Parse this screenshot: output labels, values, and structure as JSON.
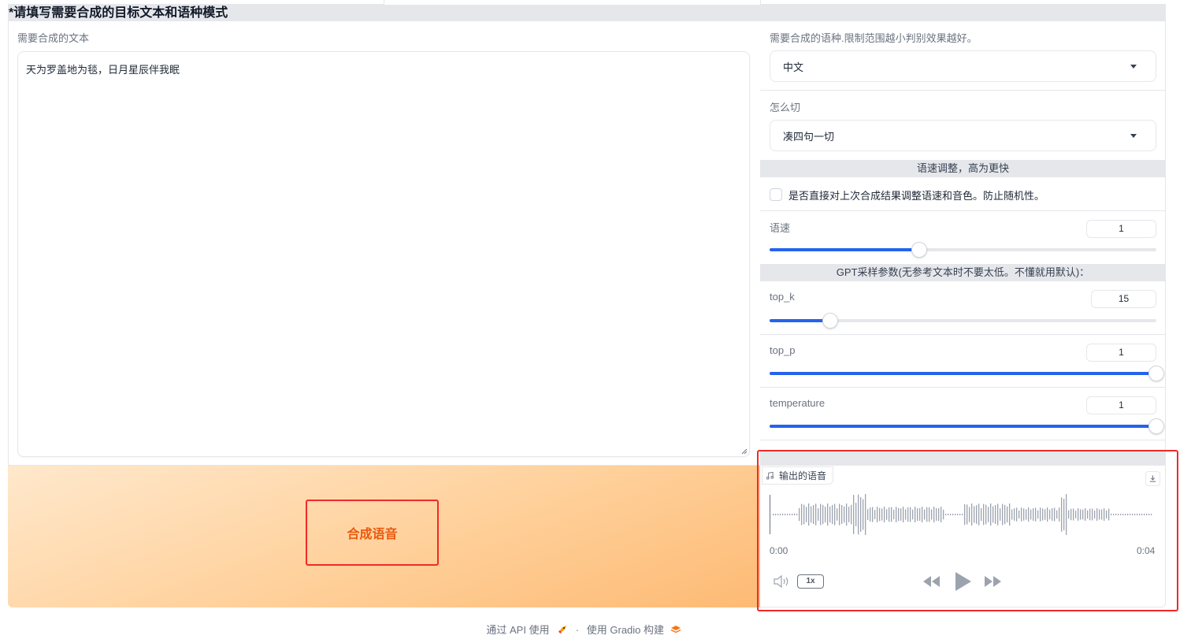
{
  "header": {
    "title": "*请填写需要合成的目标文本和语种模式"
  },
  "left": {
    "text_label": "需要合成的文本",
    "text_value": "天为罗盖地为毯，日月星辰伴我眠",
    "synth_button": "合成语音"
  },
  "right": {
    "language": {
      "label": "需要合成的语种.限制范围越小判别效果越好。",
      "value": "中文"
    },
    "cut": {
      "label": "怎么切",
      "value": "凑四句一切"
    },
    "speed_band": "语速调整，高为更快",
    "checkbox_label": "是否直接对上次合成结果调整语速和音色。防止随机性。",
    "speed": {
      "label": "语速",
      "value": "1",
      "fraction": 0.386
    },
    "gpt_band": "GPT采样参数(无参考文本时不要太低。不懂就用默认)：",
    "top_k": {
      "label": "top_k",
      "value": "15",
      "fraction": 0.156
    },
    "top_p": {
      "label": "top_p",
      "value": "1",
      "fraction": 1.0
    },
    "temperature": {
      "label": "temperature",
      "value": "1",
      "fraction": 1.0
    }
  },
  "audio": {
    "label": "输出的语音",
    "time_start": "0:00",
    "time_end": "0:04",
    "rate": "1x"
  },
  "footer": {
    "api": "通过 API 使用",
    "sep": "·",
    "built": "使用 Gradio 构建"
  },
  "colors": {
    "accent": "#2563eb",
    "button_text": "#ea580c",
    "highlight": "#ef2a2a"
  }
}
